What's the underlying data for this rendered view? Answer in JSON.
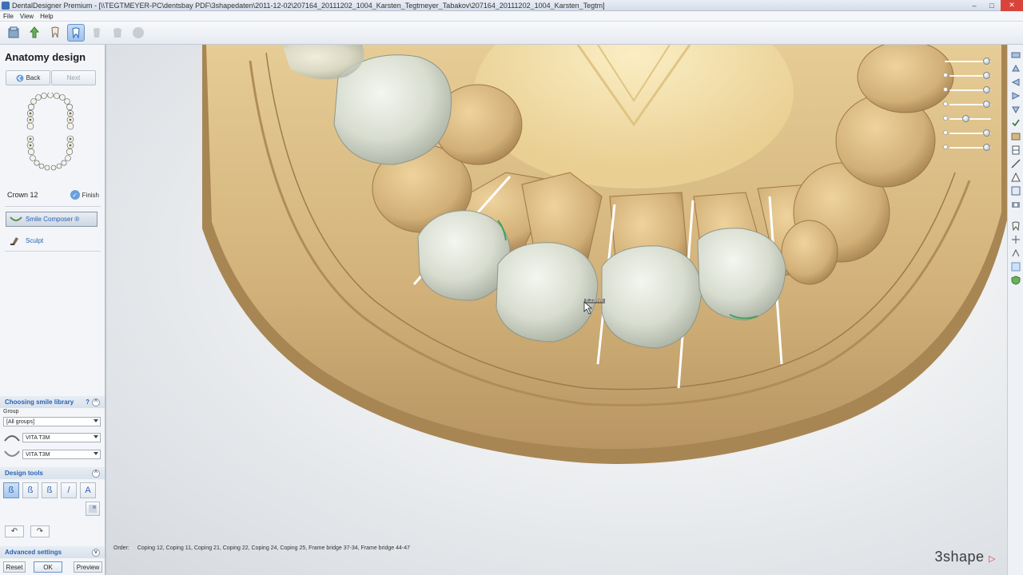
{
  "window": {
    "title": "DentalDesigner Premium - [\\\\TEGTMEYER-PC\\dentsbay PDF\\3shapedaten\\2011-12-02\\207164_20111202_1004_Karsten_Tegtmeyer_Tabakov\\207164_20111202_1004_Karsten_Tegtm]",
    "minimize": "–",
    "maximize": "□",
    "close": "✕"
  },
  "menu": [
    "File",
    "View",
    "Help"
  ],
  "toolbar": {
    "icons": [
      "order-icon",
      "upload-icon",
      "tooth-icon",
      "anatomy-design-icon",
      "crown-icon",
      "model-icon",
      "finish-icon"
    ]
  },
  "left_panel": {
    "title": "Anatomy design",
    "back_label": "Back",
    "next_label": "Next",
    "crown_label": "Crown 12",
    "finish_label": "Finish",
    "steps": {
      "smile_composer": "Smile Composer ®",
      "sculpt": "Sculpt"
    },
    "smile_library": {
      "header": "Choosing smile library",
      "group_label": "Group",
      "group_value": "[All groups]",
      "library_upper": "VITA T3M",
      "library_lower": "VITA T3M"
    },
    "design_tools": {
      "header": "Design tools",
      "tools": [
        "ß",
        "ß",
        "ß",
        "/",
        "A"
      ]
    },
    "advanced": {
      "header": "Advanced settings"
    },
    "buttons": {
      "reset": "Reset",
      "ok": "OK",
      "preview": "Preview"
    }
  },
  "viewport": {
    "order_label": "Order:",
    "order_value": "Coping 12, Coping 11, Coping 21, Coping 22, Coping 24, Coping 25, Frame bridge 37-34, Frame bridge 44-47",
    "cursor_label": "0.23mm",
    "logo_text": "3shape",
    "logo_mark": "▷"
  },
  "colors": {
    "model": "#d6b77f",
    "model_dark": "#a88653",
    "crown": "#d8ddd0",
    "accent": "#2a63b3",
    "logo_red": "#d9443a"
  }
}
